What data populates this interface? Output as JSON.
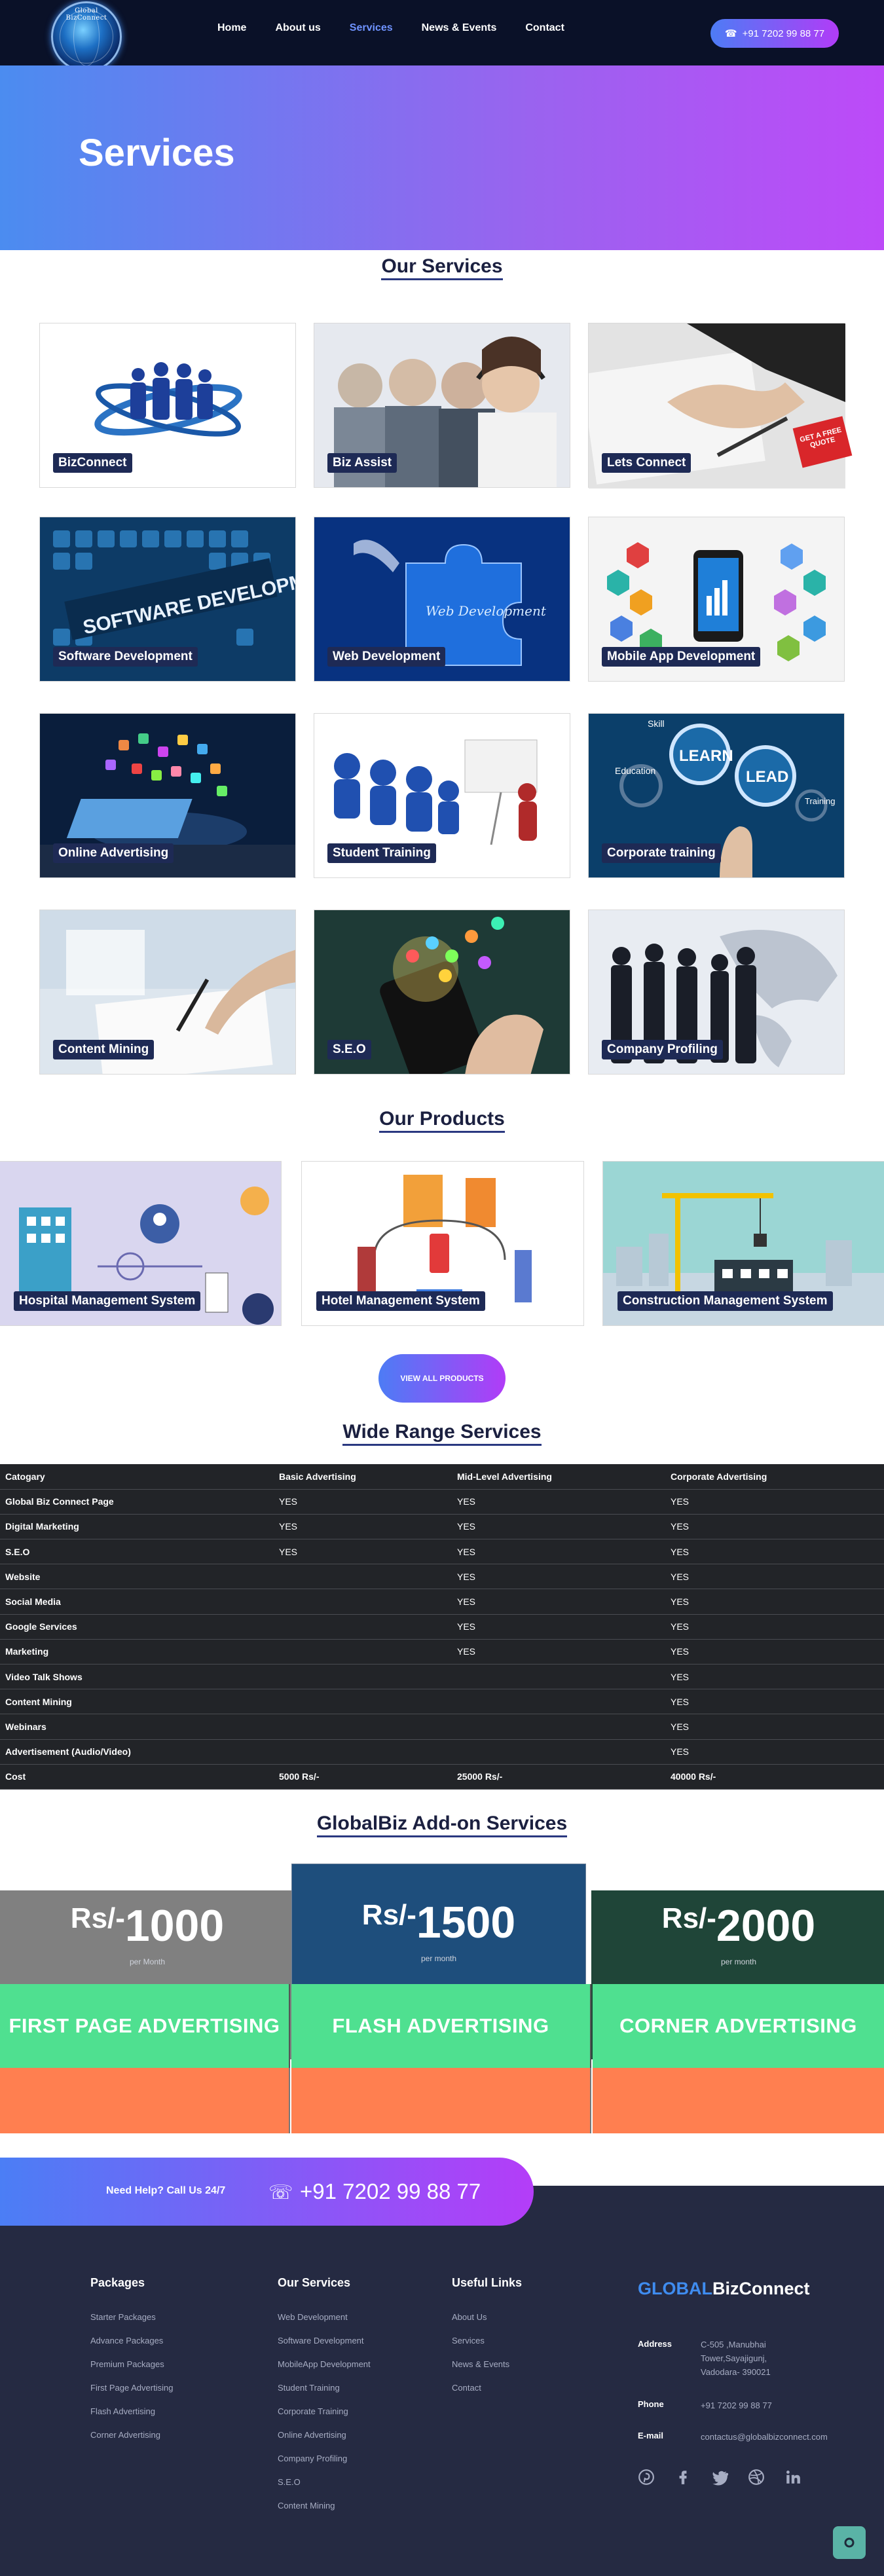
{
  "nav": {
    "logo_text": "Global BizConnect",
    "links": [
      "Home",
      "About us",
      "Services",
      "News & Events",
      "Contact"
    ],
    "phone": "+91 7202 99 88 77"
  },
  "hero": {
    "title": "Services"
  },
  "our_services": {
    "title": "Our Services",
    "items": [
      "BizConnect",
      "Biz Assist",
      "Lets Connect",
      "Software Development",
      "Web Development",
      "Mobile App Development",
      "Online Advertising",
      "Student Training",
      "Corporate training",
      "Content Mining",
      "S.E.O",
      "Company Profiling"
    ],
    "ribbon": "GET A FREE QUOTE"
  },
  "our_products": {
    "title": "Our Products",
    "items": [
      "Hospital Management System",
      "Hotel Management System",
      "Construction Management System"
    ],
    "view_all": "VIEW ALL PRODUCTS"
  },
  "wide_range": {
    "title": "Wide Range Services",
    "headers": [
      "Catogary",
      "Basic Advertising",
      "Mid-Level Advertising",
      "Corporate Advertising"
    ],
    "rows": [
      [
        "Global Biz Connect Page",
        "YES",
        "YES",
        "YES"
      ],
      [
        "Digital Marketing",
        "YES",
        "YES",
        "YES"
      ],
      [
        "S.E.O",
        "YES",
        "YES",
        "YES"
      ],
      [
        "Website",
        "",
        "YES",
        "YES"
      ],
      [
        "Social Media",
        "",
        "YES",
        "YES"
      ],
      [
        "Google Services",
        "",
        "YES",
        "YES"
      ],
      [
        "Marketing",
        "",
        "YES",
        "YES"
      ],
      [
        "Video Talk Shows",
        "",
        "",
        "YES"
      ],
      [
        "Content Mining",
        "",
        "",
        "YES"
      ],
      [
        "Webinars",
        "",
        "",
        "YES"
      ],
      [
        "Advertisement (Audio/Video)",
        "",
        "",
        "YES"
      ],
      [
        "Cost",
        "5000 Rs/-",
        "25000 Rs/-",
        "40000 Rs/-"
      ]
    ]
  },
  "addons": {
    "title": "GlobalBiz Add-on Services",
    "currency": "Rs/-",
    "plans": [
      {
        "price": "1000",
        "period": "per Month",
        "name": "FIRST PAGE ADVERTISING",
        "color": "#808080"
      },
      {
        "price": "1500",
        "period": "per month",
        "name": "FLASH ADVERTISING",
        "color": "#1e4e7c"
      },
      {
        "price": "2000",
        "period": "per month",
        "name": "CORNER ADVERTISING",
        "color": "#1f4538"
      }
    ]
  },
  "help": {
    "label": "Need Help? Call Us 24/7",
    "phone": "+91 7202 99 88 77"
  },
  "footer": {
    "packages": {
      "title": "Packages",
      "items": [
        "Starter Packages",
        "Advance Packages",
        "Premium Packages",
        "First Page Advertising",
        "Flash Advertising",
        "Corner Advertising"
      ]
    },
    "services": {
      "title": "Our Services",
      "items": [
        "Web Development",
        "Software Development",
        "MobileApp Development",
        "Student Training",
        "Corporate Training",
        "Online Advertising",
        "Company Profiling",
        "S.E.O",
        "Content Mining"
      ]
    },
    "links": {
      "title": "Useful Links",
      "items": [
        "About Us",
        "Services",
        "News & Events",
        "Contact"
      ]
    },
    "brand_a": "GLOBAL",
    "brand_b": "BizConnect",
    "address_label": "Address",
    "address": "C-505 ,Manubhai Tower,Sayajigunj, Vadodara- 390021",
    "phone_label": "Phone",
    "phone": "+91 7202 99 88 77",
    "email_label": "E-mail",
    "email": "contactus@globalbizconnect.com",
    "social": [
      "pinterest-icon",
      "facebook-icon",
      "twitter-icon",
      "dribbble-icon",
      "linkedin-icon"
    ]
  }
}
